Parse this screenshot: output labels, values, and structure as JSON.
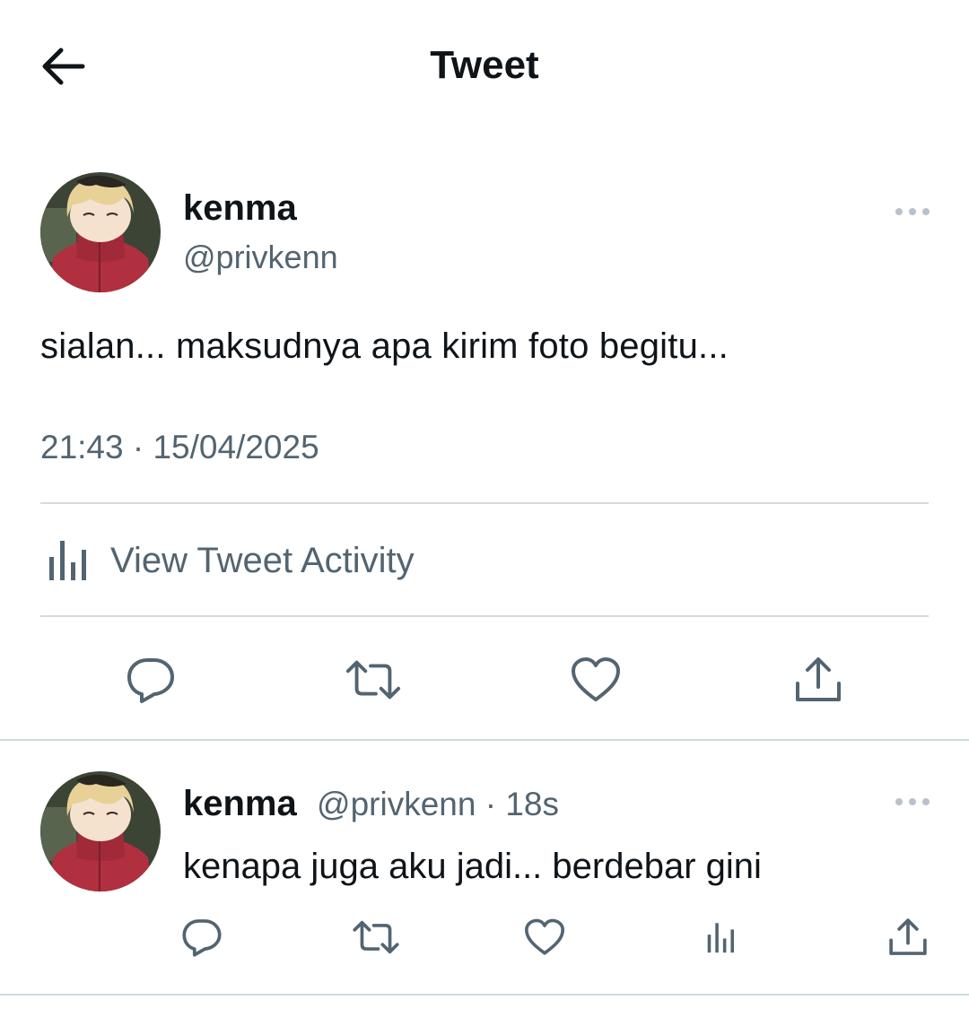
{
  "header": {
    "title": "Tweet",
    "back_icon": "arrow-left-icon"
  },
  "tweet": {
    "author": {
      "name": "kenma",
      "handle": "@privkenn"
    },
    "text": "sialan... maksudnya apa kirim foto begitu...",
    "timestamp": "21:43 · 15/04/2025",
    "activity_label": "View Tweet Activity",
    "actions": [
      "reply-icon",
      "retweet-icon",
      "like-icon",
      "share-icon"
    ]
  },
  "reply": {
    "author": {
      "name": "kenma",
      "handle": "@privkenn"
    },
    "time_sep": " · ",
    "time": "18s",
    "text": "kenapa juga aku jadi... berdebar gini",
    "actions": [
      "reply-icon",
      "retweet-icon",
      "like-icon",
      "analytics-icon",
      "share-icon"
    ]
  },
  "colors": {
    "text_primary": "#0f1419",
    "text_secondary": "#536471",
    "divider": "#cfd9de",
    "avatar_sweater": "#b0303f",
    "avatar_hair": "#e7d196"
  }
}
